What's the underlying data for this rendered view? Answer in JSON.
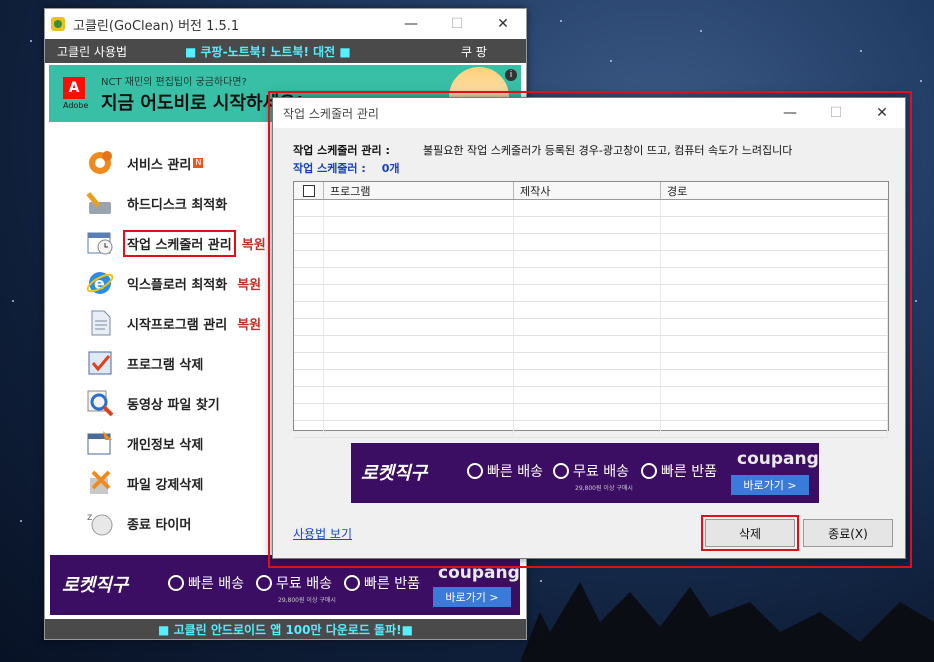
{
  "main_window": {
    "title": "고클린(GoClean) 버전 1.5.1",
    "controls": {
      "minimize": "—",
      "maximize": "☐",
      "close": "✕"
    },
    "menubar": {
      "guide": "고클린 사용법",
      "promo": "■ 쿠팡-노트북! 노트북! 대전 ■",
      "coupang": "쿠 팡"
    },
    "banner": {
      "brand": "Adobe",
      "small_text": "NCT 재민의 편집팁이 궁금하다면?",
      "big_text": "지금 어도비로 시작하세요!",
      "info": "i"
    },
    "menu": [
      {
        "label": "서비스 관리",
        "badge": "N",
        "restore": ""
      },
      {
        "label": "하드디스크 최적화",
        "badge": "",
        "restore": ""
      },
      {
        "label": "작업 스케줄러 관리",
        "badge": "",
        "restore": "복원"
      },
      {
        "label": "익스플로러 최적화",
        "badge": "",
        "restore": "복원"
      },
      {
        "label": "시작프로그램 관리",
        "badge": "",
        "restore": "복원"
      },
      {
        "label": "프로그램 삭제",
        "badge": "",
        "restore": ""
      },
      {
        "label": "동영상 파일 찾기",
        "badge": "",
        "restore": ""
      },
      {
        "label": "개인정보 삭제",
        "badge": "",
        "restore": ""
      },
      {
        "label": "파일 강제삭제",
        "badge": "",
        "restore": ""
      },
      {
        "label": "종료 타이머",
        "badge": "",
        "restore": ""
      }
    ],
    "footer": "■ 고클린 안드로이드 앱 100만 다운로드 돌파!■"
  },
  "coupang_ad": {
    "rocket": "로켓직구",
    "feature1": "빠른 배송",
    "feature2": "무료 배송",
    "feature3": "빠른 반품",
    "subnote": "29,800원 이상 구매시",
    "logo": "coupang",
    "button": "바로가기 >"
  },
  "dialog": {
    "title": "작업 스케줄러 관리",
    "desc_key": "작업 스케줄러 관리 :",
    "desc_value": "불필요한 작업 스케줄러가 등록된 경우-광고창이 뜨고, 컴퓨터 속도가 느려집니다",
    "count_key": "작업 스케줄러 :",
    "count_value": "0개",
    "columns": [
      "프로그램",
      "제작사",
      "경로"
    ],
    "help_link": "사용법 보기",
    "delete_button": "삭제",
    "close_button": "종료(X)"
  },
  "colors": {
    "highlight": "#e0101a",
    "promo_text": "#54f0ff",
    "restore_text": "#c0302d",
    "count_text": "#1540c5",
    "ad_bg": "#3b0e63"
  }
}
